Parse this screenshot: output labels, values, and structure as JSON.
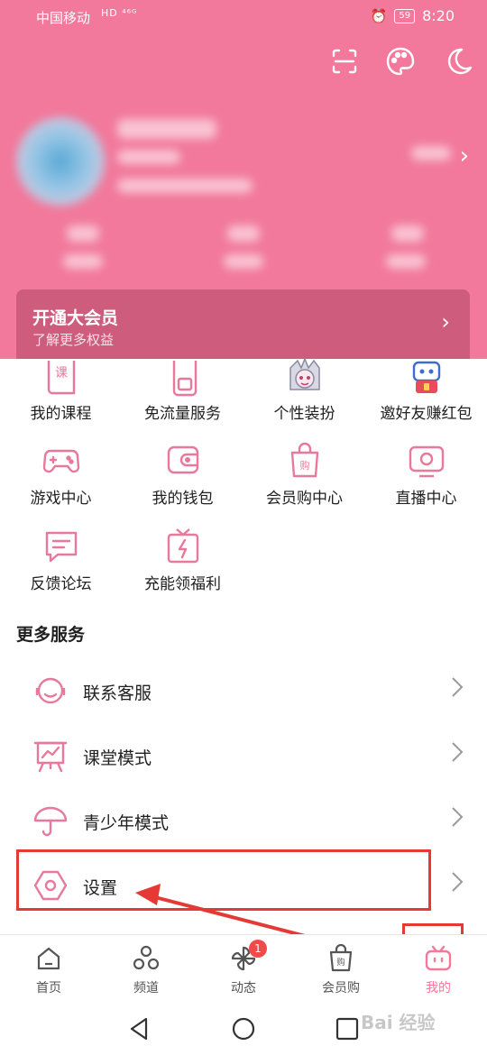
{
  "status_bar": {
    "carrier": "中国移动",
    "network": "HD ⁴⁶ᴳ",
    "battery": "59",
    "time": "8:20"
  },
  "header": {
    "top_icons": [
      "scan-icon",
      "palette-icon",
      "moon-icon"
    ],
    "vip_banner": {
      "title": "开通大会员",
      "subtitle": "了解更多权益"
    }
  },
  "grid": {
    "items": [
      {
        "label": "我的课程",
        "icon": "course-icon"
      },
      {
        "label": "免流量服务",
        "icon": "sim-card-icon"
      },
      {
        "label": "个性装扮",
        "icon": "character-avatar-icon"
      },
      {
        "label": "邀好友赚红包",
        "icon": "tv-mascot-icon"
      },
      {
        "label": "游戏中心",
        "icon": "gamepad-icon"
      },
      {
        "label": "我的钱包",
        "icon": "wallet-icon"
      },
      {
        "label": "会员购中心",
        "icon": "shopping-bag-icon"
      },
      {
        "label": "直播中心",
        "icon": "live-tv-icon"
      },
      {
        "label": "反馈论坛",
        "icon": "chat-icon"
      },
      {
        "label": "充能领福利",
        "icon": "gift-icon"
      }
    ]
  },
  "more_services": {
    "title": "更多服务",
    "items": [
      {
        "label": "联系客服",
        "icon": "headset-icon"
      },
      {
        "label": "课堂模式",
        "icon": "classroom-icon"
      },
      {
        "label": "青少年模式",
        "icon": "umbrella-icon"
      },
      {
        "label": "设置",
        "icon": "settings-icon"
      }
    ]
  },
  "bottom_nav": {
    "items": [
      {
        "label": "首页",
        "icon": "home-icon"
      },
      {
        "label": "频道",
        "icon": "channel-icon"
      },
      {
        "label": "动态",
        "icon": "pinwheel-icon"
      },
      {
        "label": "会员购",
        "icon": "shop-bag-icon"
      },
      {
        "label": "我的",
        "icon": "tv-icon"
      }
    ],
    "dynamic_badge": "1",
    "active_index": 4
  },
  "watermark": "Bai 经验",
  "colors": {
    "brand_pink": "#f2799c",
    "vip_banner": "#cd5c7d",
    "icon_pink": "#e8799a",
    "highlight_red": "#e53935"
  }
}
